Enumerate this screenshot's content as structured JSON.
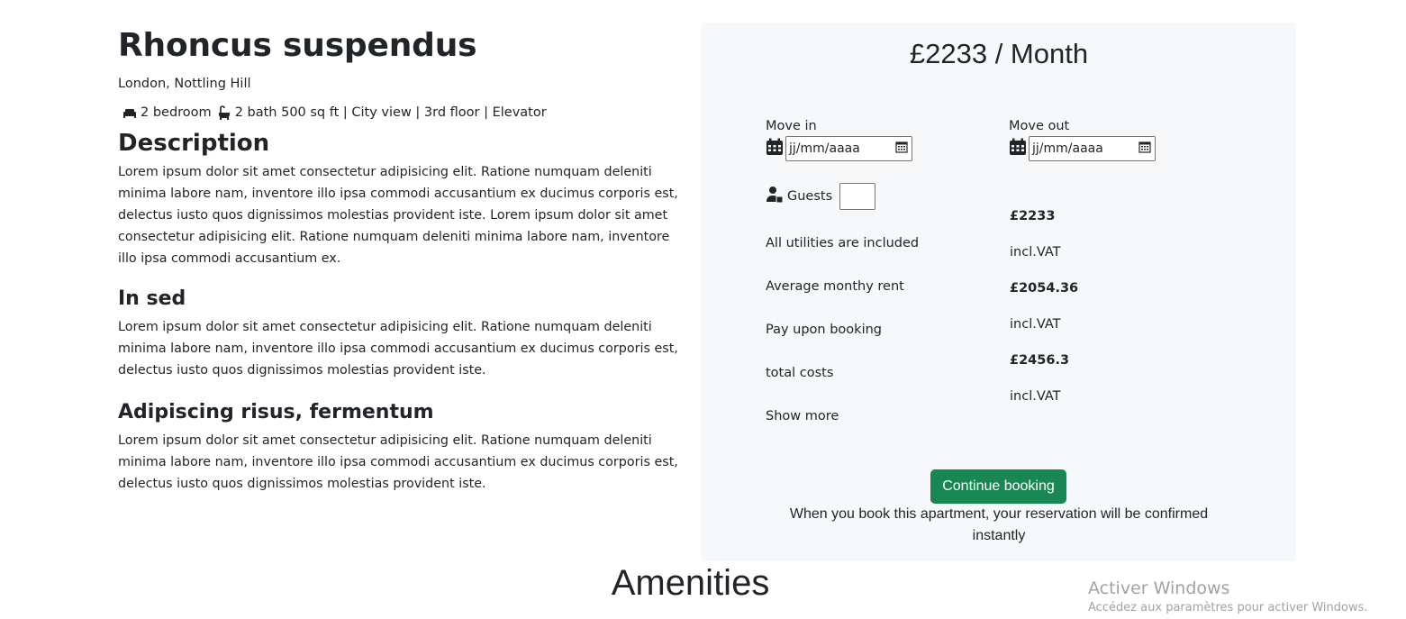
{
  "listing": {
    "title": "Rhoncus suspendus",
    "location": "London, Nottling Hill",
    "bedrooms": "2 bedroom",
    "details": "2 bath 500 sq ft | City view | 3rd floor | Elevator"
  },
  "description": {
    "heading": "Description",
    "text": "Lorem ipsum dolor sit amet consectetur adipisicing elit. Ratione numquam deleniti minima labore nam, inventore illo ipsa commodi accusantium ex ducimus corporis est, delectus iusto quos dignissimos molestias provident iste. Lorem ipsum dolor sit amet consectetur adipisicing elit. Ratione numquam deleniti minima labore nam, inventore illo ipsa commodi accusantium ex."
  },
  "section2": {
    "heading": "In sed",
    "text": "Lorem ipsum dolor sit amet consectetur adipisicing elit. Ratione numquam deleniti minima labore nam, inventore illo ipsa commodi accusantium ex ducimus corporis est, delectus iusto quos dignissimos molestias provident iste."
  },
  "section3": {
    "heading": "Adipiscing risus, fermentum",
    "text": "Lorem ipsum dolor sit amet consectetur adipisicing elit. Ratione numquam deleniti minima labore nam, inventore illo ipsa commodi accusantium ex ducimus corporis est, delectus iusto quos dignissimos molestias provident iste."
  },
  "booking": {
    "price": "£2233 / Month",
    "move_in_label": "Move in",
    "move_out_label": "Move out",
    "date_placeholder": "jj/mm/aaaa",
    "guests_label": "Guests",
    "guests_value": "",
    "rows": {
      "utilities_label": "All utilities are included",
      "rent_label": "Average monthy rent",
      "pay_label": "Pay upon booking",
      "total_label": "total costs",
      "show_more": "Show more",
      "value1": "£2233",
      "vat1": "incl.VAT",
      "value2": "£2054.36",
      "vat2": "incl.VAT",
      "value3": "£2456.3",
      "vat3": "incl.VAT"
    },
    "button_label": "Continue booking",
    "note": "When you book this apartment, your reservation will be confirmed instantly"
  },
  "amenities_heading": "Amenities",
  "watermark": {
    "title": "Activer Windows",
    "subtitle": "Accédez aux paramètres pour activer Windows."
  },
  "colors": {
    "accent": "#198754",
    "panel_bg": "#f7f8f9",
    "text": "#212529"
  },
  "icons": [
    "bed-icon",
    "bath-icon",
    "calendar-icon",
    "calendar-picker-icon",
    "user-icon"
  ]
}
